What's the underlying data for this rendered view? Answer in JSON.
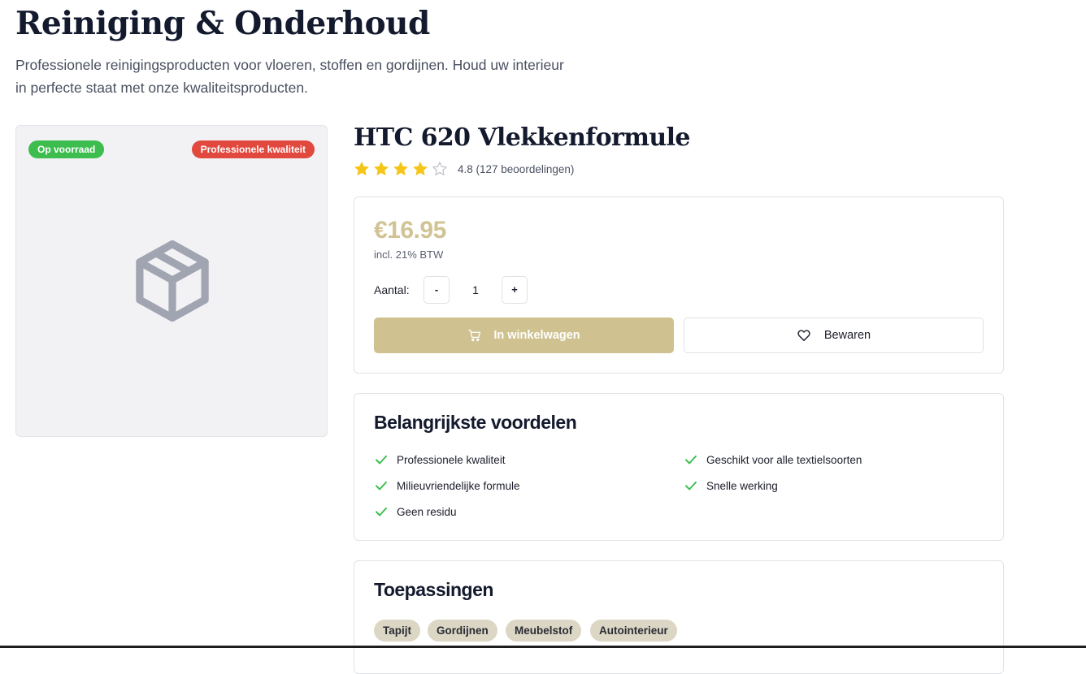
{
  "header": {
    "title": "Reiniging & Onderhoud",
    "subtitle": "Professionele reinigingsproducten voor vloeren, stoffen en gordijnen. Houd uw interieur in perfecte staat met onze kwaliteitsproducten."
  },
  "product_image": {
    "stock_badge": "Op voorraad",
    "quality_badge": "Professionele kwaliteit",
    "placeholder_icon": "package-box-icon"
  },
  "product": {
    "title": "HTC 620 Vlekkenformule",
    "rating": 4.8,
    "stars_filled": 4,
    "stars_total": 5,
    "rating_text": "4.8 (127 beoordelingen)",
    "price": "€16.95",
    "vat_note": "incl. 21% BTW",
    "quantity_label": "Aantal:",
    "quantity_minus": "-",
    "quantity_value": "1",
    "quantity_plus": "+",
    "add_to_cart_label": "In winkelwagen",
    "add_to_cart_icon": "cart-icon",
    "save_label": "Bewaren",
    "save_icon": "heart-icon"
  },
  "benefits": {
    "heading": "Belangrijkste voordelen",
    "items": [
      "Professionele kwaliteit",
      "Geschikt voor alle textielsoorten",
      "Milieuvriendelijke formule",
      "Snelle werking",
      "Geen residu"
    ]
  },
  "applications": {
    "heading": "Toepassingen",
    "tags": [
      "Tapijt",
      "Gordijnen",
      "Meubelstof",
      "Autointerieur"
    ]
  },
  "colors": {
    "accent_gold": "#cfc190",
    "price_gold": "#d1c394",
    "stock_green": "#3dbd4e",
    "quality_red": "#e1483e",
    "star_yellow": "#f5c518",
    "check_green": "#3cbf4f",
    "tag_beige": "#dcd6c4"
  }
}
